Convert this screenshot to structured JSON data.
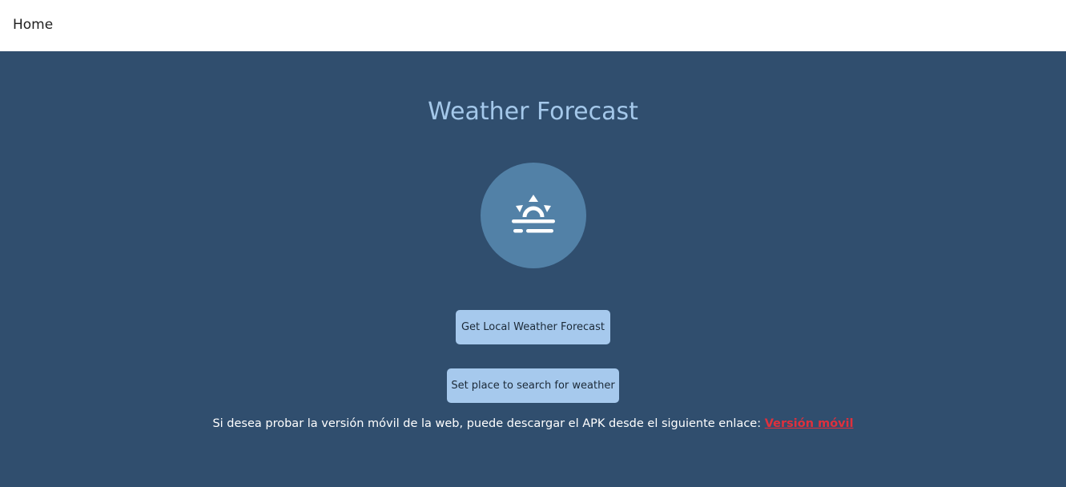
{
  "nav": {
    "home_label": "Home"
  },
  "main": {
    "title": "Weather Forecast",
    "logo_icon": "sun-horizon-icon",
    "buttons": {
      "local_forecast": "Get Local Weather Forecast",
      "set_place": "Set place to search for weather"
    },
    "apk_note": {
      "text": "Si desea probar la versión móvil de la web, puede descargar el APK desde el siguiente enlace: ",
      "link_label": "Versión móvil"
    }
  },
  "colors": {
    "background": "#304e6e",
    "title": "#a4c8ea",
    "logo_circle": "#5281a7",
    "button": "#a6c9ed",
    "link": "#e0303c"
  }
}
